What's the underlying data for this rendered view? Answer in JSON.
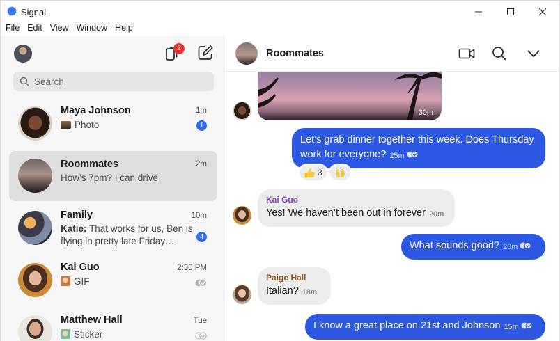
{
  "app": {
    "title": "Signal"
  },
  "menu": [
    "File",
    "Edit",
    "View",
    "Window",
    "Help"
  ],
  "sidebar": {
    "stories_count": "2",
    "search_placeholder": "Search",
    "conversations": [
      {
        "name": "Maya Johnson",
        "time": "1m",
        "preview": "Photo",
        "unread": "1"
      },
      {
        "name": "Roommates",
        "time": "2m",
        "preview": "How’s 7pm? I can drive"
      },
      {
        "name": "Family",
        "time": "10m",
        "sender": "Katie:",
        "preview": "That works for us, Ben is flying in pretty late Friday…",
        "unread": "4"
      },
      {
        "name": "Kai Guo",
        "time": "2:30 PM",
        "preview": "GIF"
      },
      {
        "name": "Matthew Hall",
        "time": "Tue",
        "preview": "Sticker"
      }
    ]
  },
  "chat": {
    "title": "Roommates",
    "image_time": "30m",
    "messages": [
      {
        "text": "Let’s grab dinner together this week. Does Thursday work for everyone?",
        "time": "25m"
      },
      {
        "sender": "Kai Guo",
        "sender_color": "#8a43c9",
        "text": "Yes! We haven’t been out in forever",
        "time": "20m"
      },
      {
        "text": "What sounds good?",
        "time": "20m"
      },
      {
        "sender": "Paige Hall",
        "sender_color": "#8c5a1e",
        "text": "Italian?",
        "time": "18m"
      },
      {
        "text": "I know a great place on 21st and Johnson",
        "time": "15m"
      }
    ],
    "reactions": [
      {
        "emoji": "thumbs-up-icon",
        "count": "3"
      },
      {
        "emoji": "raising-hands-icon",
        "count": ""
      }
    ]
  },
  "colors": {
    "accent": "#2c58e4",
    "badge": "#e4312f",
    "unread": "#2c6bed"
  }
}
